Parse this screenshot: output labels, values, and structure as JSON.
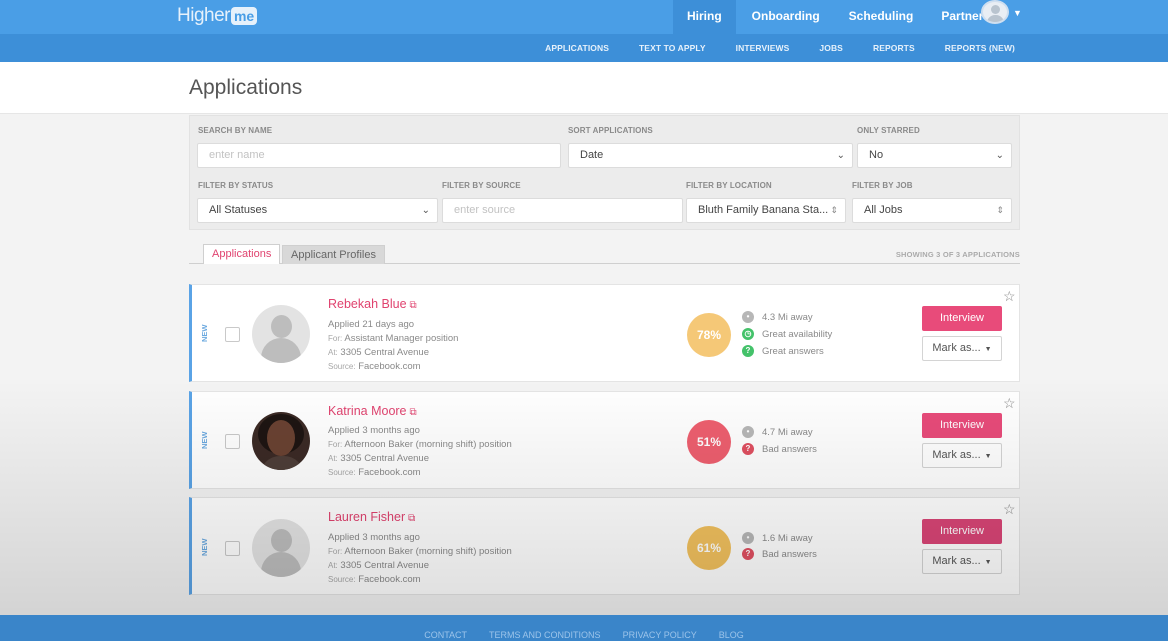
{
  "brand": {
    "logo_text": "Higher",
    "logo_badge": "me"
  },
  "topnav": {
    "items": [
      "Hiring",
      "Onboarding",
      "Scheduling",
      "Partners"
    ]
  },
  "subnav": {
    "items": [
      "APPLICATIONS",
      "TEXT TO APPLY",
      "INTERVIEWS",
      "JOBS",
      "REPORTS",
      "REPORTS (NEW)"
    ]
  },
  "page": {
    "title": "Applications"
  },
  "filters": {
    "search_label": "SEARCH BY NAME",
    "search_placeholder": "enter name",
    "sort_label": "SORT APPLICATIONS",
    "sort_value": "Date",
    "starred_label": "ONLY STARRED",
    "starred_value": "No",
    "status_label": "FILTER BY STATUS",
    "status_value": "All Statuses",
    "source_label": "FILTER BY SOURCE",
    "source_placeholder": "enter source",
    "location_label": "FILTER BY LOCATION",
    "location_value": "Bluth Family Banana Sta...",
    "job_label": "FILTER BY JOB",
    "job_value": "All Jobs"
  },
  "tabs": {
    "applications": "Applications",
    "profiles": "Applicant Profiles",
    "showing": "SHOWING 3 OF 3 APPLICATIONS"
  },
  "applicants": [
    {
      "badge": "NEW",
      "name": "Rebekah Blue",
      "applied": "Applied 21 days ago",
      "for_label": "For:",
      "for_value": "Assistant Manager position",
      "at_label": "At:",
      "at_value": "3305 Central Avenue",
      "source_label": "Source:",
      "source_value": "Facebook.com",
      "score": "78%",
      "score_color": "#f5c877",
      "indicators": [
        {
          "text": "4.3 Mi away",
          "icon": "location-icon",
          "color": "gray"
        },
        {
          "text": "Great availability",
          "icon": "clock-icon",
          "color": "green"
        },
        {
          "text": "Great answers",
          "icon": "question-icon",
          "color": "green"
        }
      ],
      "interview": "Interview",
      "mark": "Mark as..."
    },
    {
      "badge": "NEW",
      "name": "Katrina Moore",
      "applied": "Applied 3 months ago",
      "for_label": "For:",
      "for_value": "Afternoon Baker (morning shift) position",
      "at_label": "At:",
      "at_value": "3305 Central Avenue",
      "source_label": "Source:",
      "source_value": "Facebook.com",
      "score": "51%",
      "score_color": "#ee5f6f",
      "indicators": [
        {
          "text": "4.7 Mi away",
          "icon": "location-icon",
          "color": "gray"
        },
        {
          "text": "Bad answers",
          "icon": "question-icon",
          "color": "red"
        }
      ],
      "interview": "Interview",
      "mark": "Mark as..."
    },
    {
      "badge": "NEW",
      "name": "Lauren Fisher",
      "applied": "Applied 3 months ago",
      "for_label": "For:",
      "for_value": "Afternoon Baker (morning shift) position",
      "at_label": "At:",
      "at_value": "3305 Central Avenue",
      "source_label": "Source:",
      "source_value": "Facebook.com",
      "score": "61%",
      "score_color": "#f2c15e",
      "indicators": [
        {
          "text": "1.6 Mi away",
          "icon": "location-icon",
          "color": "gray"
        },
        {
          "text": "Bad answers",
          "icon": "question-icon",
          "color": "red"
        }
      ],
      "interview": "Interview",
      "mark": "Mark as..."
    }
  ],
  "footer": {
    "links": [
      "CONTACT",
      "TERMS AND CONDITIONS",
      "PRIVACY POLICY",
      "BLOG"
    ]
  }
}
